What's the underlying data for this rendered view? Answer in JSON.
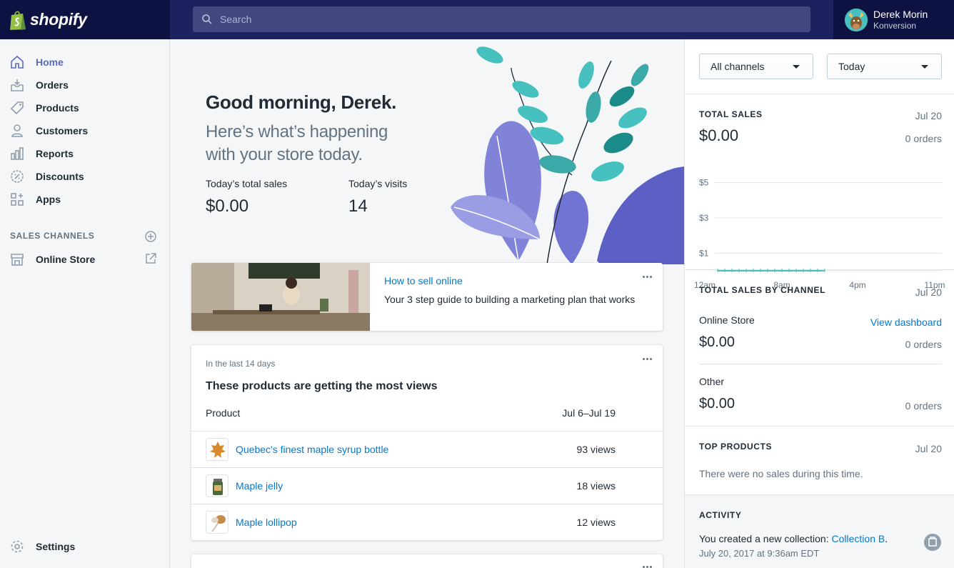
{
  "topbar": {
    "logo_text": "shopify",
    "search_placeholder": "Search",
    "user_name": "Derek Morin",
    "user_store": "Konversion"
  },
  "sidebar": {
    "items": [
      {
        "label": "Home",
        "icon": "home-icon",
        "active": true
      },
      {
        "label": "Orders",
        "icon": "orders-icon"
      },
      {
        "label": "Products",
        "icon": "tag-icon"
      },
      {
        "label": "Customers",
        "icon": "person-icon"
      },
      {
        "label": "Reports",
        "icon": "bar-chart-icon"
      },
      {
        "label": "Discounts",
        "icon": "discount-icon"
      },
      {
        "label": "Apps",
        "icon": "apps-icon"
      }
    ],
    "sales_channels_header": "SALES CHANNELS",
    "online_store": "Online Store",
    "settings": "Settings"
  },
  "hero": {
    "greeting": "Good morning, Derek.",
    "subtitle_line1": "Here’s what’s happening",
    "subtitle_line2": "with your store today.",
    "sales_label": "Today’s total sales",
    "sales_value": "$0.00",
    "visits_label": "Today’s visits",
    "visits_value": "14"
  },
  "guide_card": {
    "title": "How to sell online",
    "description": "Your 3 step guide to building a marketing plan that works"
  },
  "views_card": {
    "subtitle": "In the last 14 days",
    "title": "These products are getting the most views",
    "col_product": "Product",
    "col_range": "Jul 6–Jul 19",
    "rows": [
      {
        "name": "Quebec's finest maple syrup bottle",
        "views": "93 views"
      },
      {
        "name": "Maple jelly",
        "views": "18 views"
      },
      {
        "name": "Maple lollipop",
        "views": "12 views"
      }
    ]
  },
  "right_panel": {
    "channel_select": "All channels",
    "date_select": "Today",
    "total_sales": {
      "heading": "TOTAL SALES",
      "date": "Jul 20",
      "value": "$0.00",
      "orders": "0 orders"
    },
    "by_channel": {
      "heading": "TOTAL SALES BY CHANNEL",
      "date": "Jul 20",
      "online_store_label": "Online Store",
      "view_dashboard": "View dashboard",
      "online_store_value": "$0.00",
      "online_store_orders": "0 orders",
      "other_label": "Other",
      "other_value": "$0.00",
      "other_orders": "0 orders"
    },
    "top_products": {
      "heading": "TOP PRODUCTS",
      "date": "Jul 20",
      "empty_text": "There were no sales during this time."
    },
    "activity": {
      "heading": "ACTIVITY",
      "text_prefix": "You created a new collection: ",
      "link": "Collection B",
      "text_suffix": ".",
      "timestamp": "July 20, 2017 at 9:36am EDT"
    }
  },
  "chart_data": {
    "type": "line",
    "y_tick_labels": [
      "$5",
      "$3",
      "$1"
    ],
    "x_tick_labels": [
      "12am",
      "8am",
      "4pm",
      "11pm"
    ],
    "series": [
      {
        "values": [
          0,
          0,
          0,
          0,
          0,
          0,
          0,
          0,
          0,
          0,
          0,
          0,
          0,
          0,
          0,
          0
        ]
      }
    ],
    "color": "#47c1bf"
  },
  "colors": {
    "topbar": "#1c2260",
    "accent": "#5c6ac4",
    "link": "#007ace",
    "teal": "#47c1bf"
  }
}
